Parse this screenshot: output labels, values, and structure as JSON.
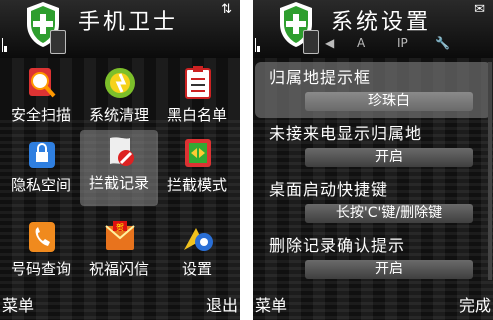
{
  "left_screen": {
    "title": "手机卫士",
    "apps": [
      {
        "label": "安全扫描",
        "icon": "magnifier-scan-icon"
      },
      {
        "label": "系统清理",
        "icon": "cleanup-icon"
      },
      {
        "label": "黑白名单",
        "icon": "checklist-icon"
      },
      {
        "label": "隐私空间",
        "icon": "lock-icon"
      },
      {
        "label": "拦截记录",
        "icon": "block-record-icon",
        "selected": true
      },
      {
        "label": "拦截模式",
        "icon": "block-mode-icon"
      },
      {
        "label": "号码查询",
        "icon": "phone-lookup-icon"
      },
      {
        "label": "祝福闪信",
        "icon": "greeting-sms-icon"
      },
      {
        "label": "设置",
        "icon": "settings-gear-icon"
      }
    ],
    "softkeys": {
      "left": "菜单",
      "right": "退出"
    }
  },
  "right_screen": {
    "title": "系统设置",
    "tabs": [
      "◀",
      "A",
      "IP",
      "🔧"
    ],
    "settings": [
      {
        "label": "归属地提示框",
        "value": "珍珠白",
        "selected": true
      },
      {
        "label": "未接来电显示归属地",
        "value": "开启"
      },
      {
        "label": "桌面启动快捷键",
        "value": "长按'C'键/删除键"
      },
      {
        "label": "删除记录确认提示",
        "value": "开启"
      }
    ],
    "softkeys": {
      "left": "菜单",
      "right": "完成"
    }
  },
  "colors": {
    "accent_green": "#2e9e2e",
    "selection": "#8c8c8c"
  }
}
